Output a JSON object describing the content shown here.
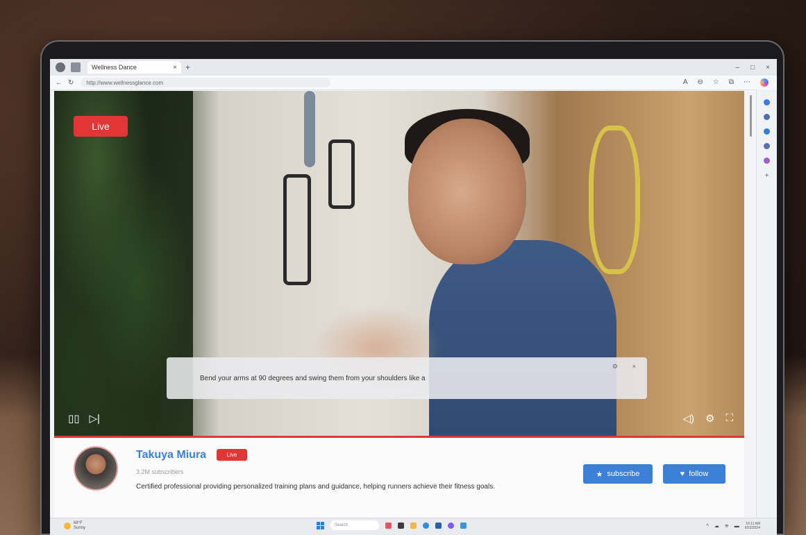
{
  "browser": {
    "tab_title": "Wellness Dance",
    "tab_close": "×",
    "new_tab": "+",
    "url": "http://www.wellnessglance.com",
    "window_controls": [
      "–",
      "□",
      "×"
    ]
  },
  "video": {
    "live_badge": "Live",
    "caption": "Bend your arms at 90 degrees and swing them from your shoulders like a",
    "caption_settings": "⚙",
    "caption_close": "×",
    "progress": 1.0
  },
  "channel": {
    "name": "Takuya Miura",
    "live_badge": "Live",
    "subscribers": "3.2M subscribers",
    "description": "Certified professional providing personalized training plans and guidance, helping runners achieve their fitness goals.",
    "subscribe_label": "subscribe",
    "follow_label": "follow"
  },
  "taskbar": {
    "weather_temp": "68°F",
    "weather_desc": "Sunny",
    "search_placeholder": "Search",
    "time": "10:11 AM",
    "date": "6/22/2024"
  },
  "icons": {
    "pause": "pause-icon",
    "next": "next-icon",
    "volume": "volume-icon",
    "settings": "gear-icon",
    "fullscreen": "fullscreen-icon",
    "star": "star-icon",
    "heart": "heart-icon"
  },
  "colors": {
    "live_red": "#e23535",
    "accent_blue": "#3b7fd6",
    "name_blue": "#3d7fd0"
  }
}
